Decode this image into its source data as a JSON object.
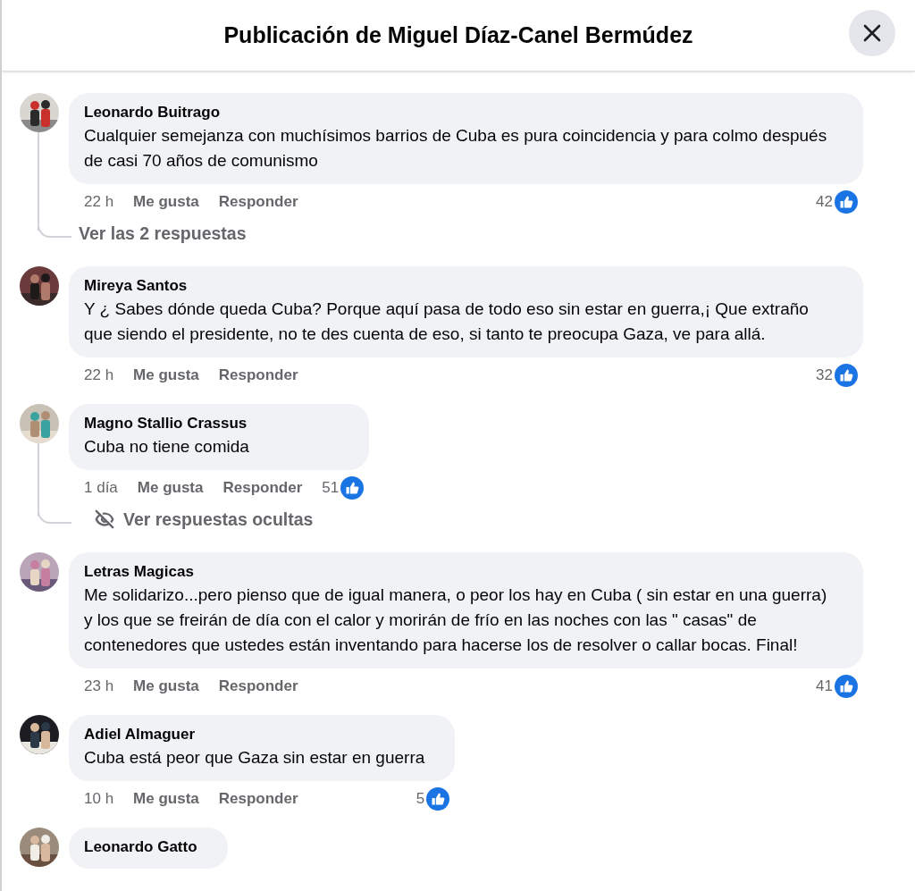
{
  "header": {
    "title": "Publicación de Miguel Díaz-Canel Bermúdez"
  },
  "comments": [
    {
      "name": "Leonardo Buitrago",
      "text": "Cualquier semejanza con muchísimos barrios de Cuba es pura coincidencia y para colmo después de casi 70 años de comunismo",
      "time": "22 h",
      "like_label": "Me gusta",
      "reply_label": "Responder",
      "likes": "42",
      "replies": {
        "kind": "count",
        "label": "Ver las 2 respuestas"
      }
    },
    {
      "name": "Mireya Santos",
      "text": "Y ¿ Sabes dónde queda Cuba? Porque aquí pasa de todo eso sin estar en guerra,¡ Que extraño que siendo el presidente, no te des cuenta de eso, si tanto te preocupa Gaza, ve para allá.",
      "time": "22 h",
      "like_label": "Me gusta",
      "reply_label": "Responder",
      "likes": "32"
    },
    {
      "name": "Magno Stallio Crassus",
      "text": "Cuba no tiene comida",
      "time": "1 día",
      "like_label": "Me gusta",
      "reply_label": "Responder",
      "likes": "51",
      "replies": {
        "kind": "hidden",
        "label": "Ver respuestas ocultas"
      }
    },
    {
      "name": "Letras Magicas",
      "text": "Me solidarizo...pero pienso que de igual manera, o peor los hay en Cuba ( sin estar en una guerra) y los que se freirán de día con el calor y morirán de frío en las noches con las \" casas\" de contenedores que ustedes están inventando para hacerse los de resolver o callar bocas. Final!",
      "time": "23 h",
      "like_label": "Me gusta",
      "reply_label": "Responder",
      "likes": "41"
    },
    {
      "name": "Adiel Almaguer",
      "text": "Cuba está peor que Gaza sin estar en guerra",
      "time": "10 h",
      "like_label": "Me gusta",
      "reply_label": "Responder",
      "likes": "5"
    },
    {
      "name": "Leonardo Gatto"
    }
  ]
}
